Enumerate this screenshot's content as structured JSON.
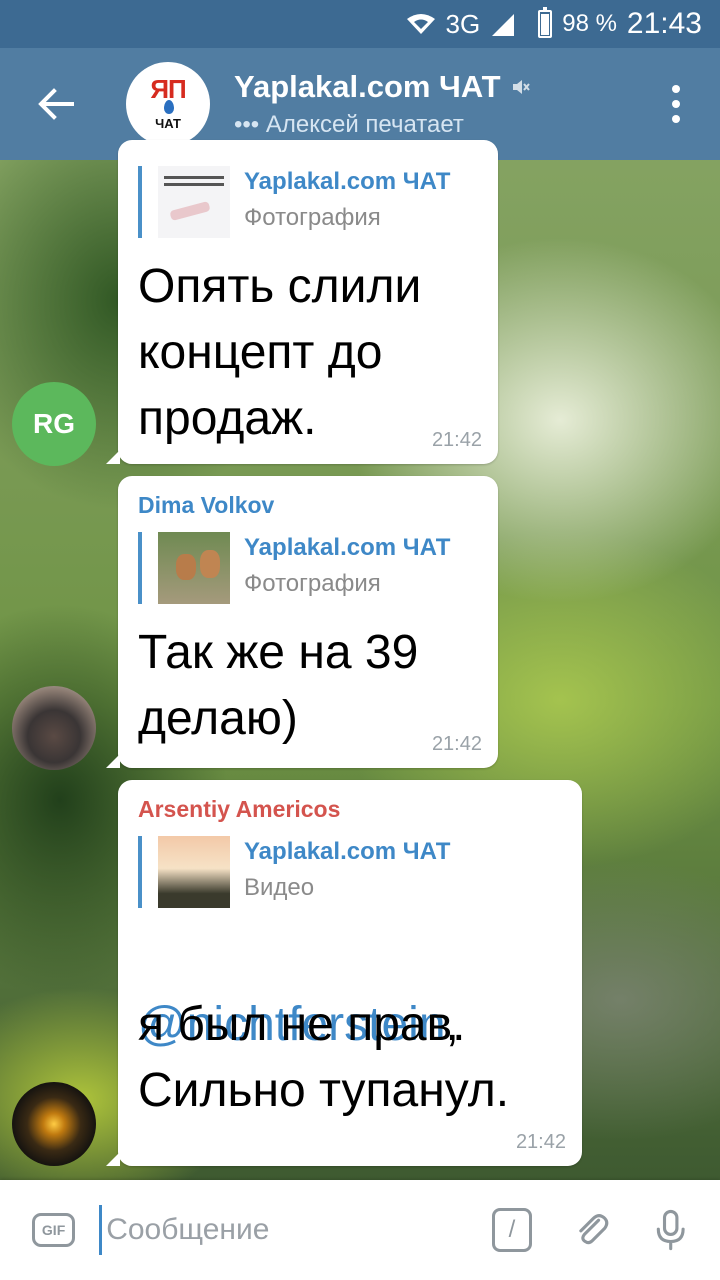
{
  "status_bar": {
    "network": "3G",
    "battery": "98 %",
    "time": "21:43"
  },
  "header": {
    "title": "Yaplakal.com ЧАТ",
    "status": "••• Алексей печатает",
    "avatar_logo_top": "ЯП",
    "avatar_logo_bottom": "ЧАТ",
    "background_color": "#517da2"
  },
  "messages": [
    {
      "sender": "",
      "reply_name": "Yaplakal.com ЧАТ",
      "reply_type": "Фотография",
      "text": "Опять слили\nконцепт до\nпродаж.",
      "time": "21:42",
      "avatar": "RG"
    },
    {
      "sender": "Dima Volkov",
      "sender_color": "#3e88c7",
      "reply_name": "Yaplakal.com ЧАТ",
      "reply_type": "Фотография",
      "text": "Так же на 39\nделаю)",
      "time": "21:42"
    },
    {
      "sender": "Arsentiy Americos",
      "sender_color": "#d4544e",
      "reply_name": "Yaplakal.com ЧАТ",
      "reply_type": "Видео",
      "mention": "@nichtferstein",
      "text_after_mention": ",",
      "text": "я был не прав.\nСильно тупанул.",
      "time": "21:42"
    }
  ],
  "composer": {
    "gif_label": "GIF",
    "placeholder": "Сообщение",
    "command_label": "/"
  }
}
